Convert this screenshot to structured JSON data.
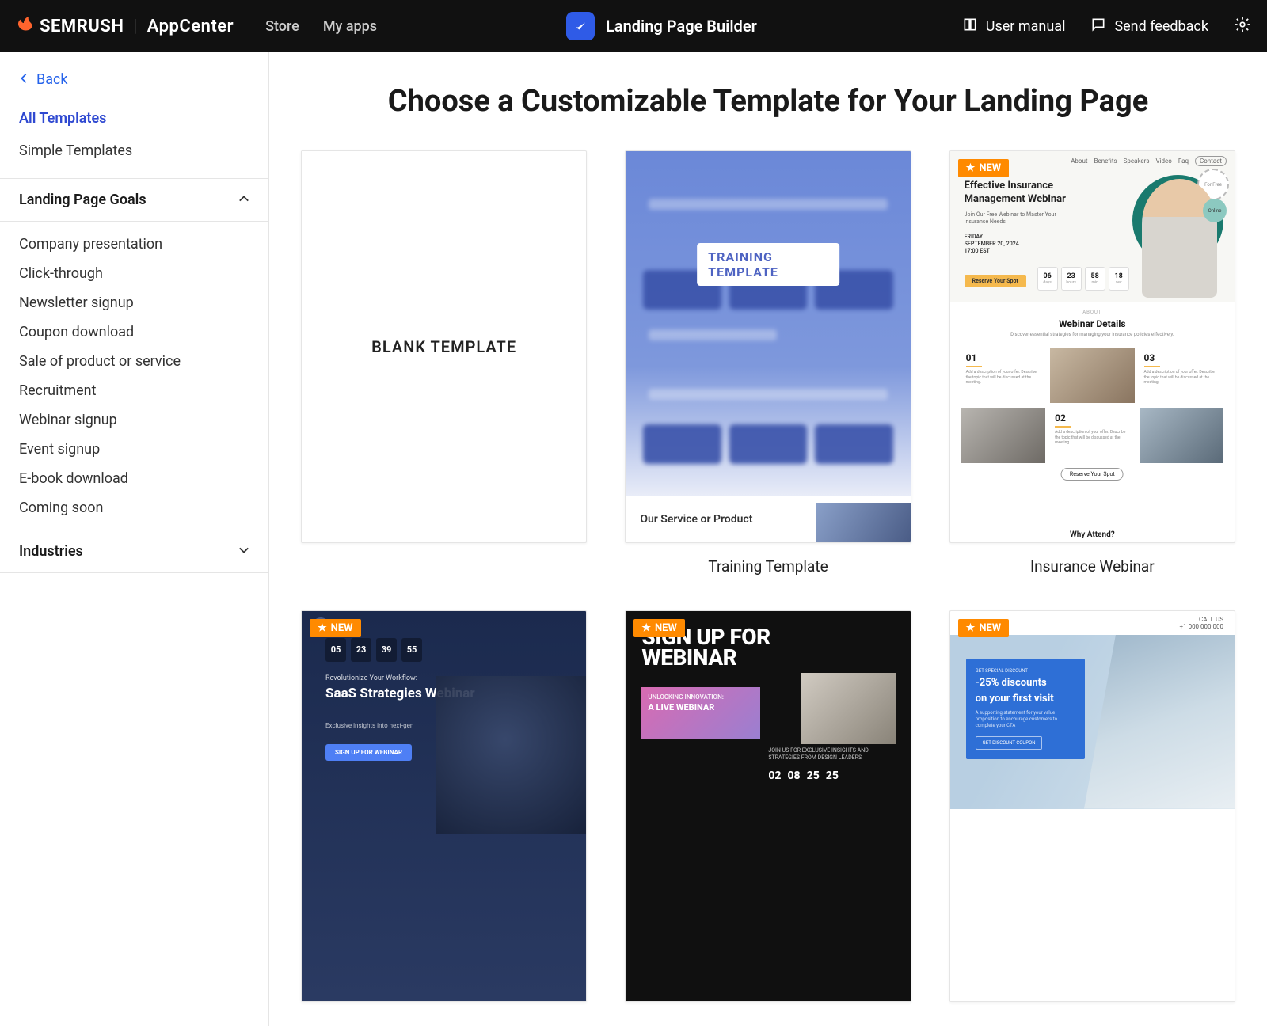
{
  "header": {
    "brand_main": "SEMRUSH",
    "brand_sub": "AppCenter",
    "nav": [
      "Store",
      "My apps"
    ],
    "app_title": "Landing Page Builder",
    "actions": {
      "manual": "User manual",
      "feedback": "Send feedback"
    }
  },
  "sidebar": {
    "back": "Back",
    "top_items": [
      {
        "label": "All Templates",
        "active": true
      },
      {
        "label": "Simple Templates",
        "active": false
      }
    ],
    "sections": [
      {
        "title": "Landing Page Goals",
        "expanded": true,
        "items": [
          "Company presentation",
          "Click-through",
          "Newsletter signup",
          "Coupon download",
          "Sale of product or service",
          "Recruitment",
          "Webinar signup",
          "Event signup",
          "E-book download",
          "Coming soon"
        ]
      },
      {
        "title": "Industries",
        "expanded": false,
        "items": []
      }
    ]
  },
  "main": {
    "title": "Choose a Customizable Template for Your Landing Page",
    "badge_new": "NEW",
    "templates": [
      {
        "title": "",
        "kind": "blank",
        "blank_label": "BLANK TEMPLATE",
        "new": false
      },
      {
        "title": "Training Template",
        "kind": "training",
        "chip": "TRAINING TEMPLATE",
        "bottom": "Our Service or Product",
        "new": false
      },
      {
        "title": "Insurance Webinar",
        "kind": "insurance",
        "new": true
      },
      {
        "title": "",
        "kind": "saas",
        "new": true
      },
      {
        "title": "",
        "kind": "wlive",
        "new": true
      },
      {
        "title": "",
        "kind": "dental",
        "new": true
      }
    ],
    "insurance": {
      "nav": [
        "About",
        "Benefits",
        "Speakers",
        "Video",
        "Faq",
        "Contact"
      ],
      "heading": "Effective Insurance Management Webinar",
      "subtitle": "Join Our Free Webinar to Master Your Insurance Needs",
      "date1": "FRIDAY",
      "date2": "SEPTEMBER 20, 2024",
      "date3": "17:00 EST",
      "cta": "Reserve Your Spot",
      "free_circle": "Online",
      "for_free": "For Free",
      "counter": [
        [
          "06",
          "days"
        ],
        [
          "23",
          "hours"
        ],
        [
          "58",
          "min"
        ],
        [
          "18",
          "sec"
        ]
      ],
      "about_label": "ABOUT",
      "details_h": "Webinar Details",
      "details_p": "Discover essential strategies for managing your insurance policies effectively.",
      "nums": [
        "01",
        "02",
        "03"
      ],
      "celltext": "Add a description of your offer. Describe the topic that will be discussed at the meeting.",
      "reserve": "Reserve Your Spot",
      "why": "Why Attend?"
    },
    "saas": {
      "counter": [
        "05",
        "23",
        "39",
        "55"
      ],
      "pre": "Revolutionize Your Workflow:",
      "heading": "SaaS Strategies Webinar",
      "sub": "Exclusive insights into next-gen",
      "btn": "SIGN UP FOR WEBINAR"
    },
    "wlive": {
      "h1a": "SIGN UP FOR",
      "h1b": "WEBINAR",
      "small": "UNLOCKING INNOVATION:",
      "big": "A LIVE WEBINAR",
      "sub": "JOIN US FOR EXCLUSIVE INSIGHTS AND STRATEGIES FROM DESIGN LEADERS",
      "counter": [
        "02",
        "08",
        "25",
        "25"
      ]
    },
    "dental": {
      "phone1": "CALL US",
      "phone2": "+1 000 000 000",
      "tag": "GET SPECIAL DISCOUNT",
      "line1": "-25% discounts",
      "line2_a": "on your ",
      "line2_b": "first visit",
      "desc": "A supporting statement for your value proposition to encourage customers to complete your CTA",
      "btn": "GET DISCOUNT COUPON"
    }
  }
}
